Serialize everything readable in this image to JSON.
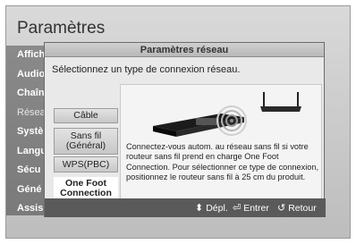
{
  "background": {
    "title": "Paramètres",
    "menu": [
      "Affich",
      "Audio",
      "Chaîn",
      "Résea",
      "Systè",
      "Langu",
      "Sécu",
      "Géné",
      "Assis"
    ]
  },
  "dialog": {
    "title": "Paramètres réseau",
    "subtitle": "Sélectionnez un type de connexion réseau.",
    "options": [
      {
        "label": "Câble"
      },
      {
        "label": "Sans fil\n(Général)"
      },
      {
        "label": "WPS(PBC)"
      },
      {
        "label": "One Foot\nConnection"
      }
    ],
    "selected_option": "One Foot\nConnection",
    "info_text": "Connectez-vous autom. au réseau sans fil si votre routeur sans fil prend en charge One Foot Connection. Pour sélectionner ce type de connexion, positionnez le routeur sans fil à 25 cm du produit.",
    "icons": [
      "bluray-player-icon",
      "wireless-router-icon",
      "signal-waves-icon"
    ]
  },
  "bottom_bar": {
    "hints": [
      {
        "icon": "updown-arrow-icon",
        "label": "Dépl."
      },
      {
        "icon": "enter-icon",
        "label": "Entrer"
      },
      {
        "icon": "return-icon",
        "label": "Retour"
      }
    ]
  }
}
